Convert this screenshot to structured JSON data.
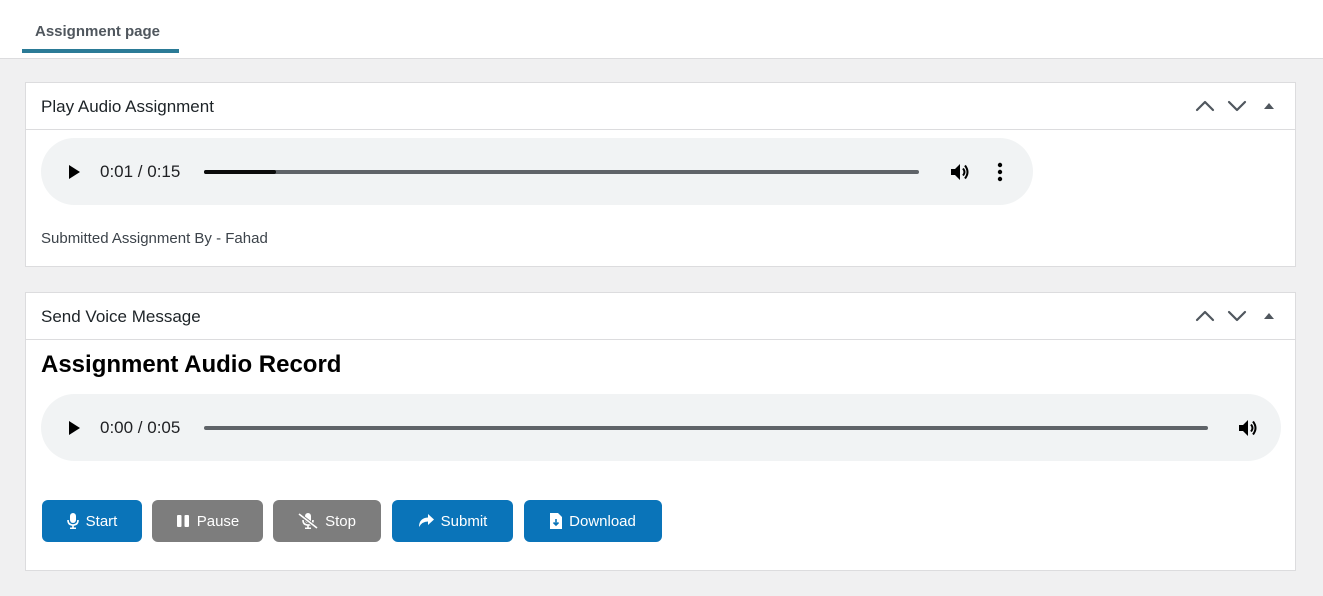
{
  "tabs": [
    {
      "label": "Assignment page",
      "active": true
    }
  ],
  "play_box": {
    "title": "Play Audio Assignment",
    "player": {
      "current": "0:01",
      "duration": "0:15",
      "time_text": "0:01 / 0:15",
      "progress": 0.1
    },
    "caption": "Submitted Assignment By - Fahad"
  },
  "voice_box": {
    "title": "Send Voice Message",
    "heading": "Assignment Audio Record",
    "player": {
      "current": "0:00",
      "duration": "0:05",
      "time_text": "0:00 / 0:05",
      "progress": 0.0
    },
    "buttons": {
      "start": "Start",
      "pause": "Pause",
      "stop": "Stop",
      "submit": "Submit",
      "download": "Download"
    }
  },
  "icons": {
    "handle": [
      "chevron-up-icon",
      "chevron-down-icon",
      "triangle-up-icon"
    ],
    "player": [
      "play-icon",
      "volume-icon",
      "more-vertical-icon"
    ],
    "buttons": [
      "microphone-icon",
      "pause-icon",
      "microphone-slash-icon",
      "share-arrow-icon",
      "file-download-icon"
    ]
  },
  "colors": {
    "tab_accent": "#2a7a96",
    "primary_button": "#0a74b9",
    "secondary_button": "#7d7d7d",
    "player_background": "#f1f3f4",
    "page_background": "#f0f0f1"
  }
}
